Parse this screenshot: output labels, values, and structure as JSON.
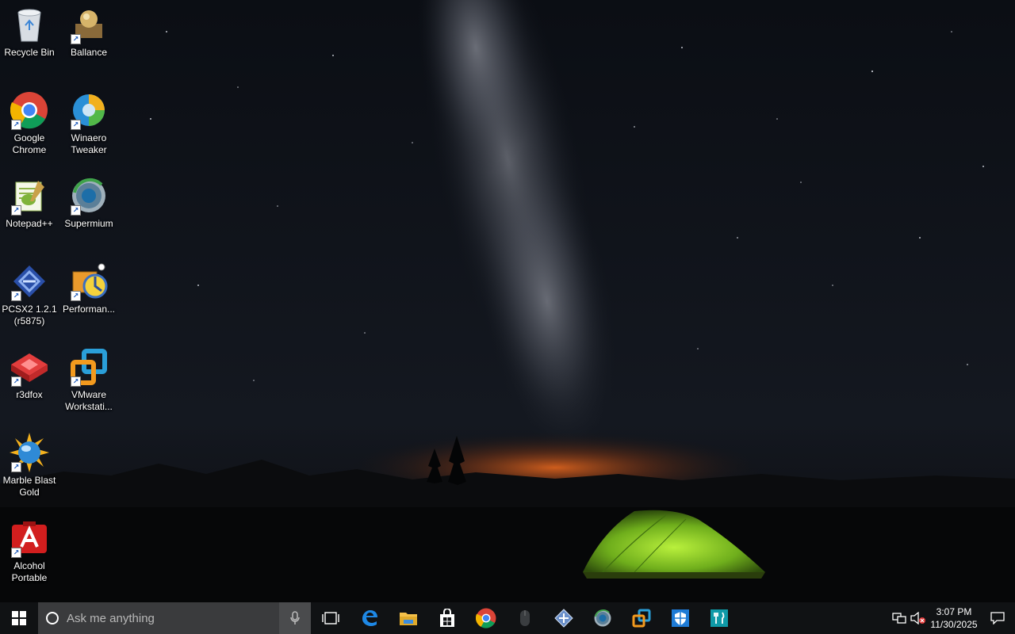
{
  "desktop": {
    "icons": [
      {
        "label": "Recycle Bin",
        "icon": "recycle-bin-icon",
        "shortcut": false
      },
      {
        "label": "Ballance",
        "icon": "ballance-icon",
        "shortcut": true
      },
      {
        "label": "Google\nChrome",
        "icon": "chrome-icon",
        "shortcut": true
      },
      {
        "label": "Winaero\nTweaker",
        "icon": "winaero-tweaker-icon",
        "shortcut": true
      },
      {
        "label": "Notepad++",
        "icon": "notepad-plus-plus-icon",
        "shortcut": true
      },
      {
        "label": "Supermium",
        "icon": "supermium-icon",
        "shortcut": true
      },
      {
        "label": "PCSX2 1.2.1\n(r5875)",
        "icon": "pcsx2-icon",
        "shortcut": true
      },
      {
        "label": "Performan...",
        "icon": "performance-icon",
        "shortcut": true
      },
      {
        "label": "r3dfox",
        "icon": "r3dfox-icon",
        "shortcut": true
      },
      {
        "label": "VMware\nWorkstati...",
        "icon": "vmware-icon",
        "shortcut": true
      },
      {
        "label": "Marble Blast\nGold",
        "icon": "marble-blast-icon",
        "shortcut": true
      },
      {
        "label": "Alcohol\nPortable",
        "icon": "alcohol-portable-icon",
        "shortcut": true
      }
    ]
  },
  "taskbar": {
    "search_placeholder": "Ask me anything",
    "pinned": [
      "task-view-icon",
      "edge-icon",
      "file-explorer-icon",
      "store-icon",
      "chrome-icon",
      "mouse-icon",
      "network-app-icon",
      "supermium-icon",
      "vmware-icon",
      "security-icon",
      "tool-icon"
    ],
    "clock": {
      "time": "3:07 PM",
      "date": "11/30/2025"
    }
  },
  "colors": {
    "taskbar": "#101214",
    "search": "#3a3b3d",
    "accent": "#8ab4e8"
  }
}
